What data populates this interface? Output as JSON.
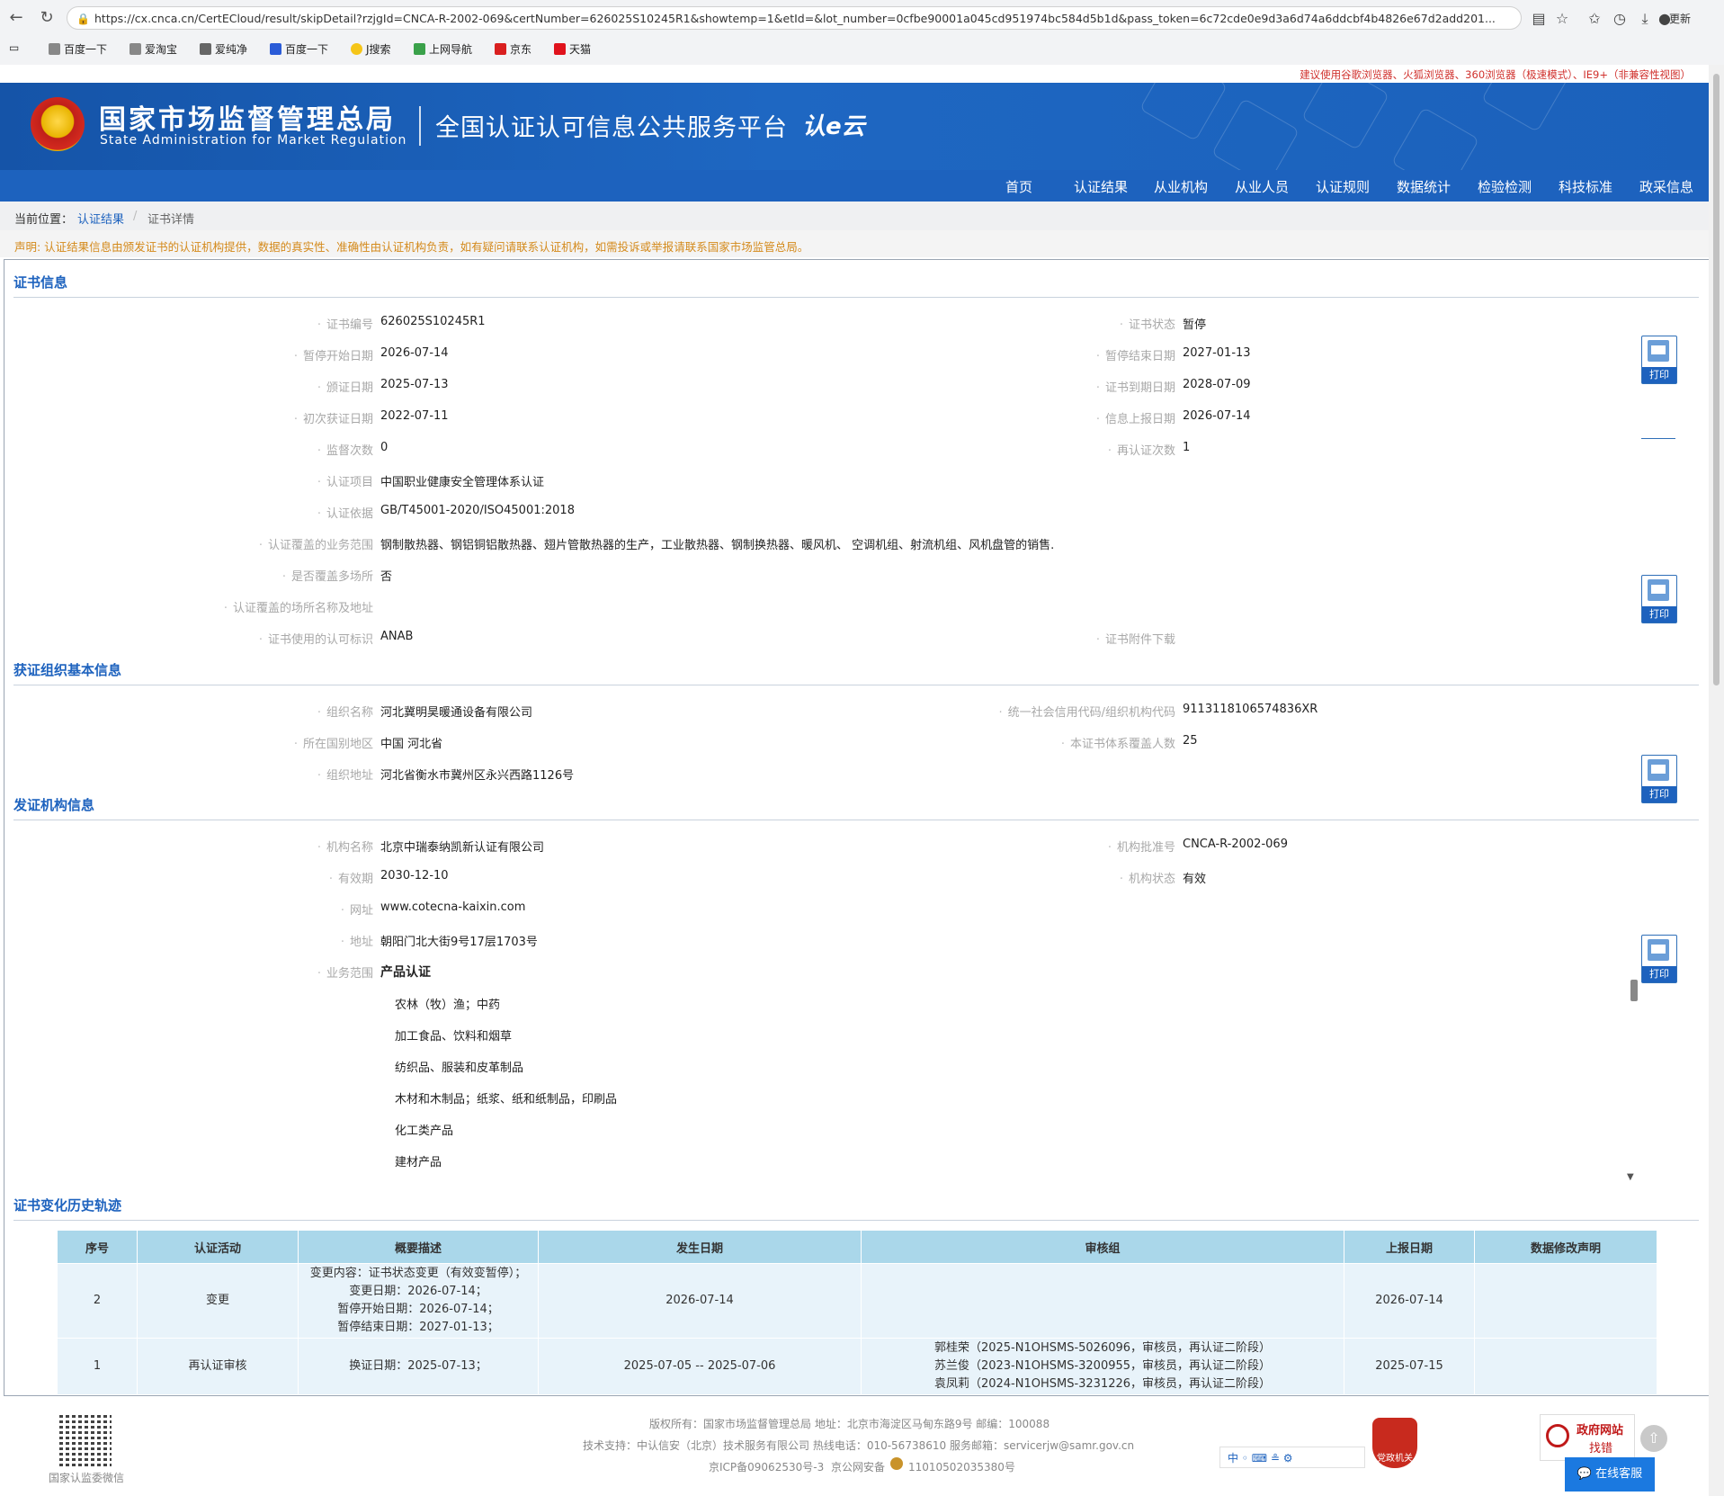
{
  "browser": {
    "url": "https://cx.cnca.cn/CertECloud/result/skipDetail?rzjgId=CNCA-R-2002-069&certNumber=626025S10245R1&showtemp=1&etId=&lot_number=0cfbe90001a045cd951974bc584d5b1d&pass_token=6c72cde0e9d3a6d74a6ddcbf4b4826e67d2add201...",
    "update_label": "更新",
    "bookmarks": [
      "百度一下",
      "爱淘宝",
      "爱纯净",
      "百度一下",
      "J搜索",
      "上网导航",
      "京东",
      "天猫"
    ]
  },
  "header": {
    "tip": "建议使用谷歌浏览器、火狐浏览器、360浏览器（极速模式）、IE9+（非兼容性视图）",
    "title_cn": "国家市场监督管理总局",
    "title_en": "State Administration  for  Market Regulation",
    "platform": "全国认证认可信息公共服务平台",
    "logo_text": "认e云"
  },
  "nav": [
    "首页",
    "认证结果",
    "从业机构",
    "从业人员",
    "认证规则",
    "数据统计",
    "检验检测",
    "科技标准",
    "政采信息"
  ],
  "breadcrumb": {
    "label": "当前位置：",
    "link": "认证结果",
    "sep": "/",
    "current": "证书详情"
  },
  "notice": "声明: 认证结果信息由颁发证书的认证机构提供，数据的真实性、准确性由认证机构负责，如有疑问请联系认证机构，如需投诉或举报请联系国家市场监管总局。",
  "print_label": "打印",
  "cert": {
    "title": "证书信息",
    "rows": [
      {
        "l1": "证书编号",
        "v1": "626025S10245R1",
        "l2": "证书状态",
        "v2": "暂停"
      },
      {
        "l1": "暂停开始日期",
        "v1": "2026-07-14",
        "l2": "暂停结束日期",
        "v2": "2027-01-13"
      },
      {
        "l1": "颁证日期",
        "v1": "2025-07-13",
        "l2": "证书到期日期",
        "v2": "2028-07-09"
      },
      {
        "l1": "初次获证日期",
        "v1": "2022-07-11",
        "l2": "信息上报日期",
        "v2": "2026-07-14"
      },
      {
        "l1": "监督次数",
        "v1": "0",
        "l2": "再认证次数",
        "v2": "1"
      },
      {
        "l1": "认证项目",
        "v1": "中国职业健康安全管理体系认证"
      },
      {
        "l1": "认证依据",
        "v1": "GB/T45001-2020/ISO45001:2018"
      },
      {
        "l1": "认证覆盖的业务范围",
        "v1": "钢制散热器、钢铝铜铝散热器、翅片管散热器的生产，工业散热器、钢制换热器、暖风机、 空调机组、射流机组、风机盘管的销售."
      },
      {
        "l1": "是否覆盖多场所",
        "v1": "否"
      },
      {
        "l1": "认证覆盖的场所名称及地址",
        "v1": ""
      },
      {
        "l1": "证书使用的认可标识",
        "v1": "ANAB",
        "l2": "证书附件下载",
        "v2": ""
      }
    ]
  },
  "org": {
    "title": "获证组织基本信息",
    "rows": [
      {
        "l1": "组织名称",
        "v1": "河北冀明昊暖通设备有限公司",
        "l2": "统一社会信用代码/组织机构代码",
        "v2": "9113118106574836XR"
      },
      {
        "l1": "所在国别地区",
        "v1": "中国 河北省",
        "l2": "本证书体系覆盖人数",
        "v2": "25"
      },
      {
        "l1": "组织地址",
        "v1": "河北省衡水市冀州区永兴西路1126号"
      }
    ]
  },
  "issuer": {
    "title": "发证机构信息",
    "rows": [
      {
        "l1": "机构名称",
        "v1": "北京中瑞泰纳凯新认证有限公司",
        "l2": "机构批准号",
        "v2": "CNCA-R-2002-069"
      },
      {
        "l1": "有效期",
        "v1": "2030-12-10",
        "l2": "机构状态",
        "v2": "有效"
      },
      {
        "l1": "网址",
        "v1": "www.cotecna-kaixin.com"
      },
      {
        "l1": "地址",
        "v1": "朝阳门北大街9号17层1703号"
      }
    ],
    "scope_label": "业务范围",
    "scope_head": "产品认证",
    "scope_items": [
      "农林（牧）渔；中药",
      "加工食品、饮料和烟草",
      "纺织品、服装和皮革制品",
      "木材和木制品；纸浆、纸和纸制品，印刷品",
      "化工类产品",
      "建材产品"
    ]
  },
  "history": {
    "title": "证书变化历史轨迹",
    "headers": [
      "序号",
      "认证活动",
      "概要描述",
      "发生日期",
      "审核组",
      "上报日期",
      "数据修改声明"
    ],
    "rows": [
      {
        "no": "2",
        "activity": "变更",
        "desc": [
          "变更内容：证书状态变更（有效变暂停）；",
          "变更日期：2026-07-14；",
          "暂停开始日期：2026-07-14；",
          "暂停结束日期：2027-01-13；"
        ],
        "date": "2026-07-14",
        "team": [],
        "report": "2026-07-14",
        "note": ""
      },
      {
        "no": "1",
        "activity": "再认证审核",
        "desc": [
          "换证日期：2025-07-13；"
        ],
        "date": "2025-07-05 -- 2025-07-06",
        "team": [
          "郭桂荣（2025-N1OHSMS-5026096，审核员，再认证二阶段）",
          "苏兰俊（2023-N1OHSMS-3200955，审核员，再认证二阶段）",
          "袁凤莉（2024-N1OHSMS-3231226，审核员，再认证二阶段）"
        ],
        "report": "2025-07-15",
        "note": ""
      }
    ]
  },
  "footer": {
    "qr_caption": "国家认监委微信",
    "line1": "版权所有：国家市场监督管理总局     地址：北京市海淀区马甸东路9号     邮编：100088",
    "line2": "技术支持：中认信安（北京）技术服务有限公司     热线电话：010-56738610     服务邮箱：servicerjw@samr.gov.cn",
    "line3a": "京ICP备09062530号-3",
    "line3b": "京公网安备",
    "line3c": "11010502035380号",
    "badge_text": "党政机关",
    "feedback1": "政府网站",
    "feedback2": "找错",
    "online": "在线客服",
    "mini_toolbar": "中 ◦ ⌨ ≗ ⚙"
  },
  "colors": {
    "brand_blue": "#1d62be",
    "label_grey": "#a8a8a8",
    "tip_red": "#d0312d",
    "notice_orange": "#d48a1c",
    "table_head": "#aad7ea"
  }
}
